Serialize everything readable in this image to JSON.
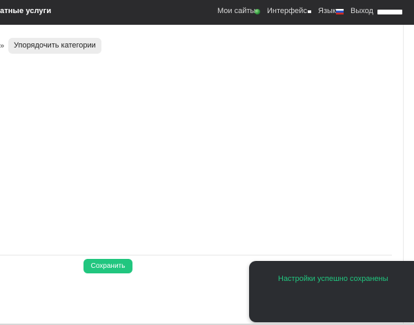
{
  "header": {
    "brand_text": "атные услуги",
    "nav": {
      "my_sites": "Мои сайты",
      "interface": "Интерфейс",
      "language": "Язык",
      "logout": "Выход"
    },
    "icons": {
      "my_sites": "globe-icon",
      "interface": "square-icon",
      "language": "russia-flag-icon",
      "profile": "profile-bar-icon"
    }
  },
  "toolbar": {
    "breadcrumb_separator": "»",
    "sort_categories_label": "Упорядочить категории"
  },
  "footer": {
    "save_label": "Сохранить"
  },
  "notification": {
    "message": "Настройки успешно сохранены"
  },
  "colors": {
    "accent": "#21C67F",
    "header_bg": "#2B2B2D",
    "toast_bg": "#2B2D31"
  }
}
